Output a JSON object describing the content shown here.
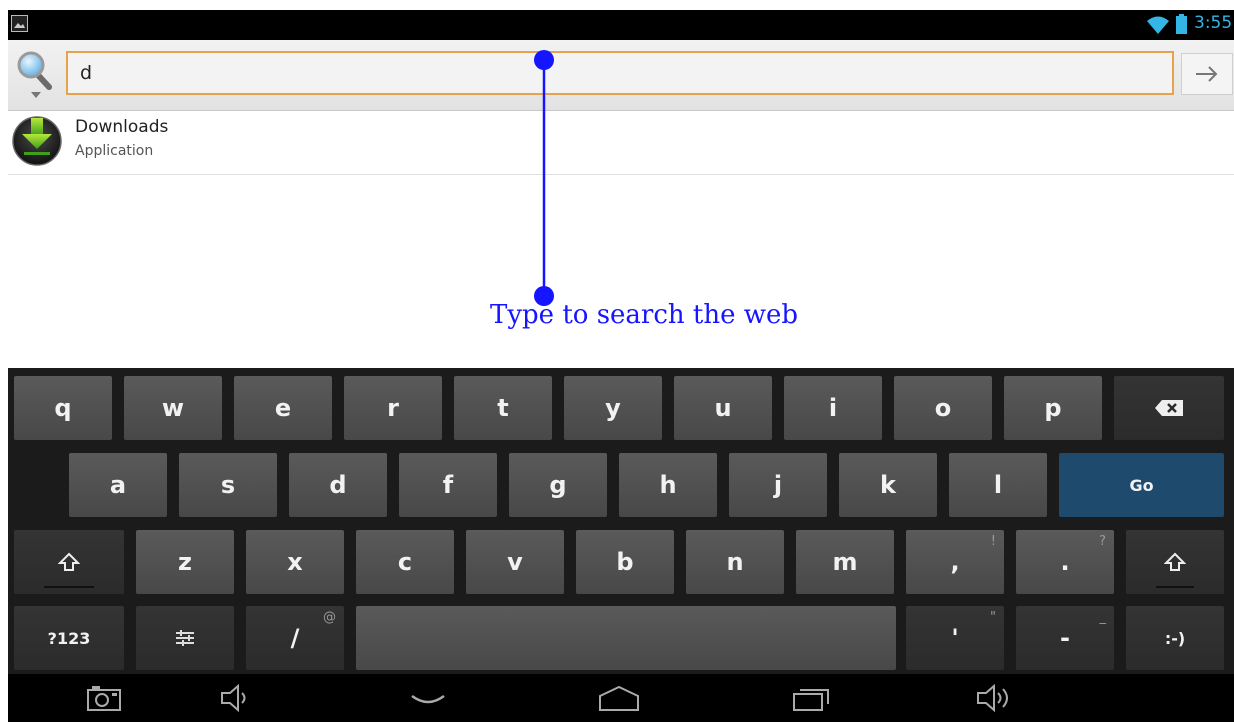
{
  "status_bar": {
    "time": "3:55",
    "icons": [
      "screenshot-icon",
      "wifi-icon",
      "battery-icon"
    ],
    "accent_color": "#33b5e5"
  },
  "search": {
    "value": "d",
    "search_icon": "magnifier-icon",
    "go_icon": "arrow-right-icon",
    "focus_color": "#e6a24c"
  },
  "results": [
    {
      "title": "Downloads",
      "subtitle": "Application",
      "icon": "download-icon"
    }
  ],
  "annotation": {
    "text": "Type to search the web",
    "color": "#1515ff"
  },
  "keyboard": {
    "row1": [
      "q",
      "w",
      "e",
      "r",
      "t",
      "y",
      "u",
      "i",
      "o",
      "p"
    ],
    "row2": [
      "a",
      "s",
      "d",
      "f",
      "g",
      "h",
      "j",
      "k",
      "l"
    ],
    "row3": [
      "z",
      "x",
      "c",
      "v",
      "b",
      "n",
      "m"
    ],
    "go_label": "Go",
    "comma_label": ",",
    "comma_hint": "!",
    "period_label": ".",
    "period_hint": "?",
    "symbols_label": "?123",
    "slash_label": "/",
    "slash_hint": "@",
    "apostrophe_label": "'",
    "apostrophe_hint": "\"",
    "dash_label": "-",
    "dash_hint": "_",
    "smiley_label": ":-)",
    "go_color": "#1e4a6e"
  },
  "nav_bar": {
    "icons": [
      "camera-icon",
      "volume-down-icon",
      "back-icon",
      "home-icon",
      "recent-apps-icon",
      "volume-up-icon"
    ]
  }
}
